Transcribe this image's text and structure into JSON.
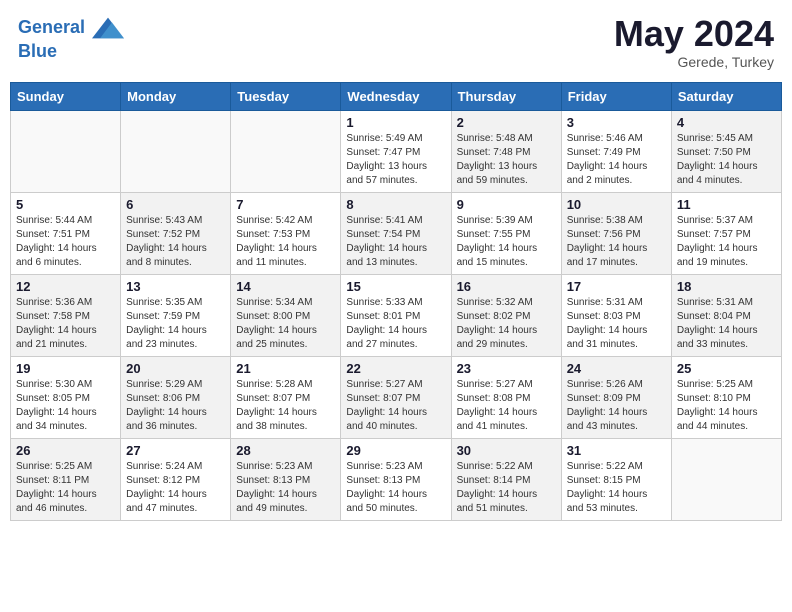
{
  "header": {
    "logo_line1": "General",
    "logo_line2": "Blue",
    "month": "May 2024",
    "location": "Gerede, Turkey"
  },
  "weekdays": [
    "Sunday",
    "Monday",
    "Tuesday",
    "Wednesday",
    "Thursday",
    "Friday",
    "Saturday"
  ],
  "weeks": [
    [
      {
        "day": "",
        "info": ""
      },
      {
        "day": "",
        "info": ""
      },
      {
        "day": "",
        "info": ""
      },
      {
        "day": "1",
        "info": "Sunrise: 5:49 AM\nSunset: 7:47 PM\nDaylight: 13 hours\nand 57 minutes."
      },
      {
        "day": "2",
        "info": "Sunrise: 5:48 AM\nSunset: 7:48 PM\nDaylight: 13 hours\nand 59 minutes."
      },
      {
        "day": "3",
        "info": "Sunrise: 5:46 AM\nSunset: 7:49 PM\nDaylight: 14 hours\nand 2 minutes."
      },
      {
        "day": "4",
        "info": "Sunrise: 5:45 AM\nSunset: 7:50 PM\nDaylight: 14 hours\nand 4 minutes."
      }
    ],
    [
      {
        "day": "5",
        "info": "Sunrise: 5:44 AM\nSunset: 7:51 PM\nDaylight: 14 hours\nand 6 minutes."
      },
      {
        "day": "6",
        "info": "Sunrise: 5:43 AM\nSunset: 7:52 PM\nDaylight: 14 hours\nand 8 minutes."
      },
      {
        "day": "7",
        "info": "Sunrise: 5:42 AM\nSunset: 7:53 PM\nDaylight: 14 hours\nand 11 minutes."
      },
      {
        "day": "8",
        "info": "Sunrise: 5:41 AM\nSunset: 7:54 PM\nDaylight: 14 hours\nand 13 minutes."
      },
      {
        "day": "9",
        "info": "Sunrise: 5:39 AM\nSunset: 7:55 PM\nDaylight: 14 hours\nand 15 minutes."
      },
      {
        "day": "10",
        "info": "Sunrise: 5:38 AM\nSunset: 7:56 PM\nDaylight: 14 hours\nand 17 minutes."
      },
      {
        "day": "11",
        "info": "Sunrise: 5:37 AM\nSunset: 7:57 PM\nDaylight: 14 hours\nand 19 minutes."
      }
    ],
    [
      {
        "day": "12",
        "info": "Sunrise: 5:36 AM\nSunset: 7:58 PM\nDaylight: 14 hours\nand 21 minutes."
      },
      {
        "day": "13",
        "info": "Sunrise: 5:35 AM\nSunset: 7:59 PM\nDaylight: 14 hours\nand 23 minutes."
      },
      {
        "day": "14",
        "info": "Sunrise: 5:34 AM\nSunset: 8:00 PM\nDaylight: 14 hours\nand 25 minutes."
      },
      {
        "day": "15",
        "info": "Sunrise: 5:33 AM\nSunset: 8:01 PM\nDaylight: 14 hours\nand 27 minutes."
      },
      {
        "day": "16",
        "info": "Sunrise: 5:32 AM\nSunset: 8:02 PM\nDaylight: 14 hours\nand 29 minutes."
      },
      {
        "day": "17",
        "info": "Sunrise: 5:31 AM\nSunset: 8:03 PM\nDaylight: 14 hours\nand 31 minutes."
      },
      {
        "day": "18",
        "info": "Sunrise: 5:31 AM\nSunset: 8:04 PM\nDaylight: 14 hours\nand 33 minutes."
      }
    ],
    [
      {
        "day": "19",
        "info": "Sunrise: 5:30 AM\nSunset: 8:05 PM\nDaylight: 14 hours\nand 34 minutes."
      },
      {
        "day": "20",
        "info": "Sunrise: 5:29 AM\nSunset: 8:06 PM\nDaylight: 14 hours\nand 36 minutes."
      },
      {
        "day": "21",
        "info": "Sunrise: 5:28 AM\nSunset: 8:07 PM\nDaylight: 14 hours\nand 38 minutes."
      },
      {
        "day": "22",
        "info": "Sunrise: 5:27 AM\nSunset: 8:07 PM\nDaylight: 14 hours\nand 40 minutes."
      },
      {
        "day": "23",
        "info": "Sunrise: 5:27 AM\nSunset: 8:08 PM\nDaylight: 14 hours\nand 41 minutes."
      },
      {
        "day": "24",
        "info": "Sunrise: 5:26 AM\nSunset: 8:09 PM\nDaylight: 14 hours\nand 43 minutes."
      },
      {
        "day": "25",
        "info": "Sunrise: 5:25 AM\nSunset: 8:10 PM\nDaylight: 14 hours\nand 44 minutes."
      }
    ],
    [
      {
        "day": "26",
        "info": "Sunrise: 5:25 AM\nSunset: 8:11 PM\nDaylight: 14 hours\nand 46 minutes."
      },
      {
        "day": "27",
        "info": "Sunrise: 5:24 AM\nSunset: 8:12 PM\nDaylight: 14 hours\nand 47 minutes."
      },
      {
        "day": "28",
        "info": "Sunrise: 5:23 AM\nSunset: 8:13 PM\nDaylight: 14 hours\nand 49 minutes."
      },
      {
        "day": "29",
        "info": "Sunrise: 5:23 AM\nSunset: 8:13 PM\nDaylight: 14 hours\nand 50 minutes."
      },
      {
        "day": "30",
        "info": "Sunrise: 5:22 AM\nSunset: 8:14 PM\nDaylight: 14 hours\nand 51 minutes."
      },
      {
        "day": "31",
        "info": "Sunrise: 5:22 AM\nSunset: 8:15 PM\nDaylight: 14 hours\nand 53 minutes."
      },
      {
        "day": "",
        "info": ""
      }
    ]
  ]
}
